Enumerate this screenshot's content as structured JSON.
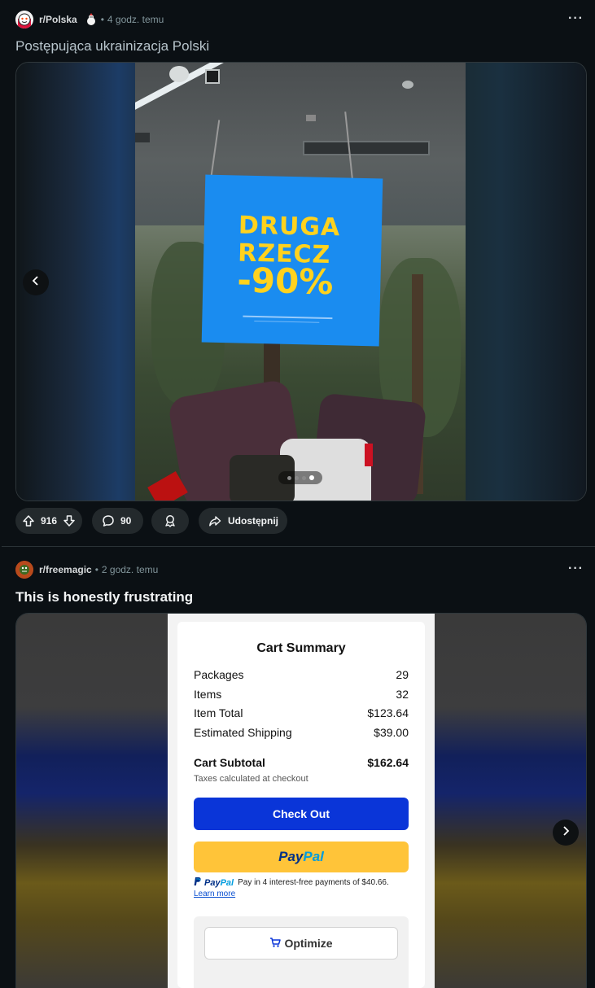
{
  "posts": [
    {
      "subreddit": "r/Polska",
      "time": "4 godz. temu",
      "title": "Postępująca ukrainizacja Polski",
      "sign": {
        "line1": "DRUGA",
        "line2": "RZECZ",
        "line3": "-90%"
      },
      "carousel": {
        "total": 4,
        "current": 4
      },
      "votes": "916",
      "comments": "90",
      "share_label": "Udostępnij"
    },
    {
      "subreddit": "r/freemagic",
      "time": "2 godz. temu",
      "title": "This is honestly frustrating",
      "cart": {
        "heading": "Cart Summary",
        "rows": [
          {
            "label": "Packages",
            "value": "29"
          },
          {
            "label": "Items",
            "value": "32"
          },
          {
            "label": "Item Total",
            "value": "$123.64"
          },
          {
            "label": "Estimated Shipping",
            "value": "$39.00"
          }
        ],
        "subtotal_label": "Cart Subtotal",
        "subtotal_value": "$162.64",
        "taxes_note": "Taxes calculated at checkout",
        "checkout_label": "Check Out",
        "paypal_pay": "Pay",
        "paypal_pal": "Pal",
        "paypal_note": "Pay in 4 interest-free payments of $40.66.",
        "learn_more": "Learn more",
        "optimize_label": "Optimize"
      }
    }
  ],
  "colors": {
    "background": "#0b1014",
    "sign_blue": "#1a8cf0",
    "sign_yellow": "#ffd21e",
    "checkout_blue": "#0a35d8",
    "paypal_yellow": "#ffc439"
  }
}
